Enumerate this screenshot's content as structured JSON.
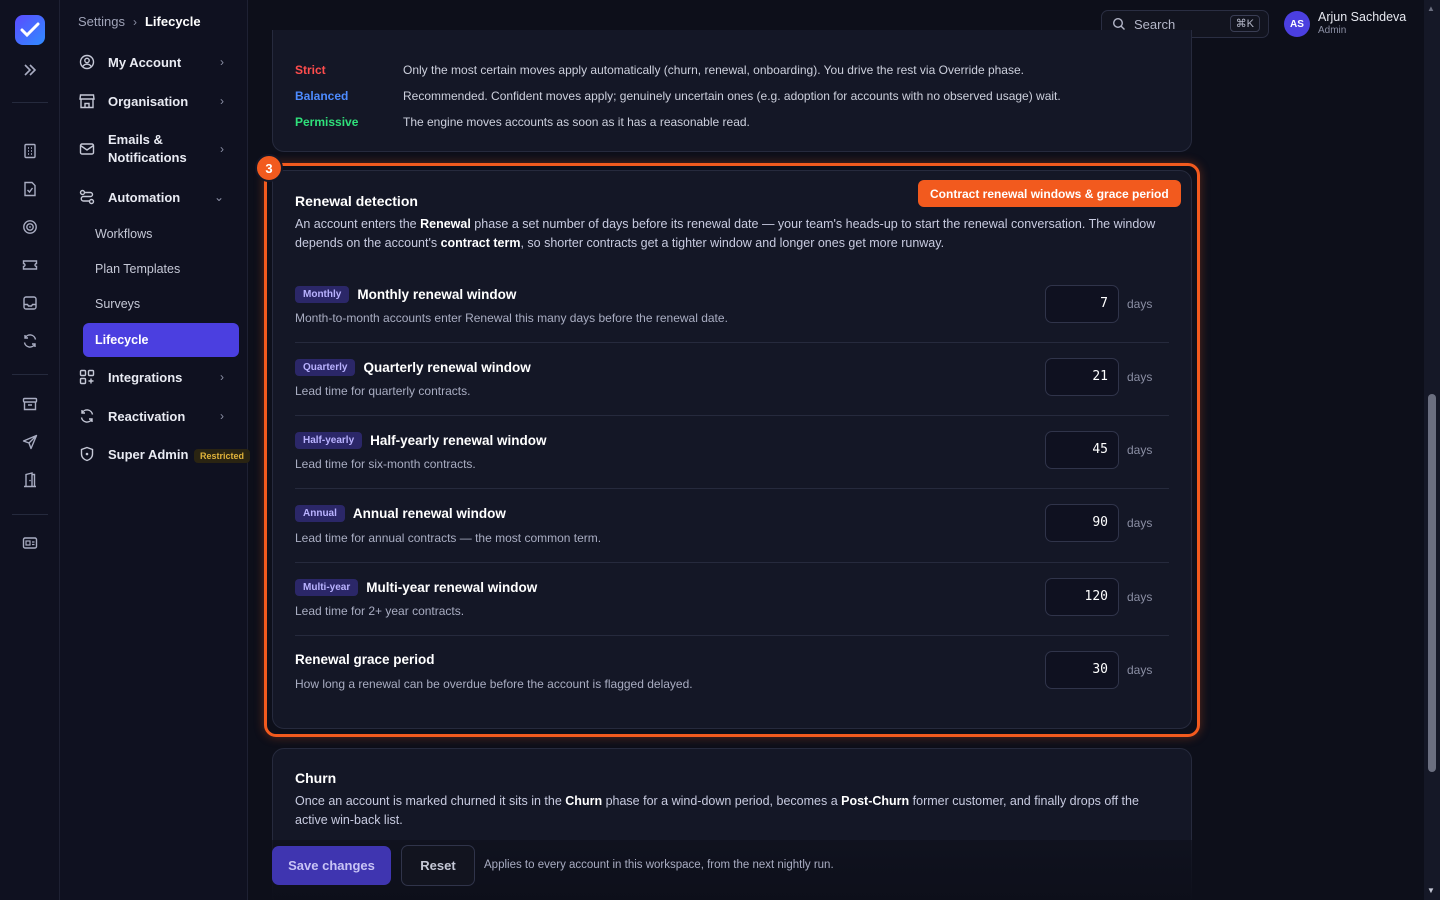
{
  "breadcrumb": {
    "root": "Settings",
    "current": "Lifecycle"
  },
  "search": {
    "placeholder": "Search",
    "shortcut": "⌘K"
  },
  "user": {
    "initials": "AS",
    "name": "Arjun Sachdeva",
    "role": "Admin"
  },
  "nav": {
    "my_account": "My Account",
    "organisation": "Organisation",
    "emails_line1": "Emails &",
    "emails_line2": "Notifications",
    "automation": "Automation",
    "workflows": "Workflows",
    "plan_templates": "Plan Templates",
    "surveys": "Surveys",
    "lifecycle": "Lifecycle",
    "integrations": "Integrations",
    "reactivation": "Reactivation",
    "super_admin": "Super Admin",
    "restricted": "Restricted"
  },
  "modes": [
    {
      "name": "Strict",
      "color": "#ff4d4d",
      "desc": "Only the most certain moves apply automatically (churn, renewal, onboarding). You drive the rest via Override phase."
    },
    {
      "name": "Balanced",
      "color": "#4d8bff",
      "desc": "Recommended. Confident moves apply; genuinely uncertain ones (e.g. adoption for accounts with no observed usage) wait."
    },
    {
      "name": "Permissive",
      "color": "#2fe07a",
      "desc": "The engine moves accounts as soon as it has a reasonable read."
    }
  ],
  "renewal": {
    "step": "3",
    "tag": "Contract renewal windows & grace period",
    "title": "Renewal detection",
    "desc_a": "An account enters the ",
    "desc_b": "Renewal",
    "desc_c": " phase a set number of days before its renewal date — your team's heads-up to start the renewal conversation. The window depends on the account's ",
    "desc_d": "contract term",
    "desc_e": ", so shorter contracts get a tighter window and longer ones get more runway.",
    "days_label": "days",
    "windows": [
      {
        "pill": "Monthly",
        "title": "Monthly renewal window",
        "sub": "Month-to-month accounts enter Renewal this many days before the renewal date.",
        "value": "7"
      },
      {
        "pill": "Quarterly",
        "title": "Quarterly renewal window",
        "sub": "Lead time for quarterly contracts.",
        "value": "21"
      },
      {
        "pill": "Half-yearly",
        "title": "Half-yearly renewal window",
        "sub": "Lead time for six-month contracts.",
        "value": "45"
      },
      {
        "pill": "Annual",
        "title": "Annual renewal window",
        "sub": "Lead time for annual contracts — the most common term.",
        "value": "90"
      },
      {
        "pill": "Multi-year",
        "title": "Multi-year renewal window",
        "sub": "Lead time for 2+ year contracts.",
        "value": "120"
      },
      {
        "pill": "",
        "title": "Renewal grace period",
        "sub": "How long a renewal can be overdue before the account is flagged delayed.",
        "value": "30"
      }
    ]
  },
  "churn": {
    "title": "Churn",
    "desc_a": "Once an account is marked churned it sits in the ",
    "desc_b": "Churn",
    "desc_c": " phase for a wind-down period, becomes a ",
    "desc_d": "Post-Churn",
    "desc_e": " former customer, and finally drops off the active win-back list."
  },
  "footer": {
    "save": "Save changes",
    "reset": "Reset",
    "note": "Applies to every account in this workspace, from the next nightly run."
  }
}
